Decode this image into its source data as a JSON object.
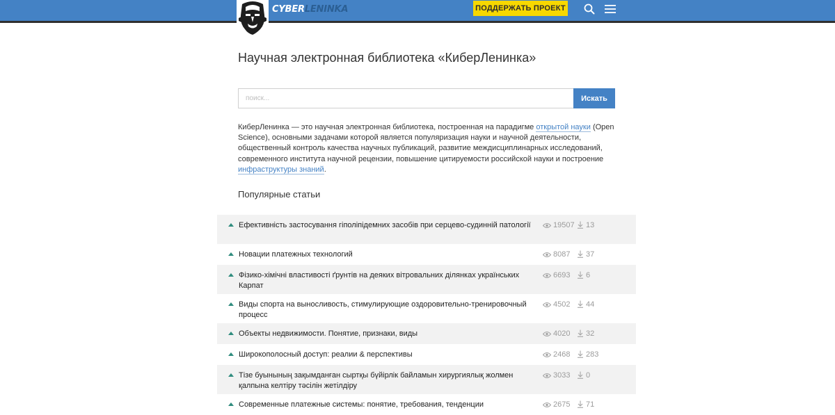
{
  "header": {
    "logo_part1": "CYBER",
    "logo_part2": "LENINKA",
    "support_label": "ПОДДЕРЖАТЬ ПРОЕКТ"
  },
  "title": "Научная электронная библиотека «КиберЛенинка»",
  "search": {
    "placeholder": "поиск...",
    "button_label": "Искать"
  },
  "description": {
    "part1": "КиберЛенинка — это научная электронная библиотека, построенная на парадигме ",
    "link1": "открытой науки",
    "part2": " (Open Science), основными задачами которой является популяризация науки и научной деятельности, общественный контроль качества научных публикаций, развитие междисциплинарных исследований, современного института научной рецензии, повышение цитируемости российской науки и построение ",
    "link2": "инфраструктуры знаний",
    "part3": "."
  },
  "popular_heading": "Популярные статьи",
  "articles": [
    {
      "title": "Ефективність застосування гіполіпідемних засобів при серцево-судинній патології",
      "views": "19507",
      "downloads": "13"
    },
    {
      "title": "Новации платежных технологий",
      "views": "8087",
      "downloads": "37"
    },
    {
      "title": "Фізико-хімічні властивості ґрунтів на деяких вітровальних ділянках українських Карпат",
      "views": "6693",
      "downloads": "6"
    },
    {
      "title": "Виды спорта на выносливость, стимулирующие оздоровительно-тренировочный процесс",
      "views": "4502",
      "downloads": "44"
    },
    {
      "title": "Объекты недвижимости. Понятие, признаки, виды",
      "views": "4020",
      "downloads": "32"
    },
    {
      "title": "Широкополосный доступ: реалии & перспективы",
      "views": "2468",
      "downloads": "283"
    },
    {
      "title": "Тізе буынының зақымданған сыртқы бүйірлік байламын хирургиялық жолмен қалпына келтіру тәсілін жетілдіру",
      "views": "3033",
      "downloads": "0"
    },
    {
      "title": "Современные платежные системы: понятие, требования, тенденции",
      "views": "2675",
      "downloads": "71"
    }
  ]
}
